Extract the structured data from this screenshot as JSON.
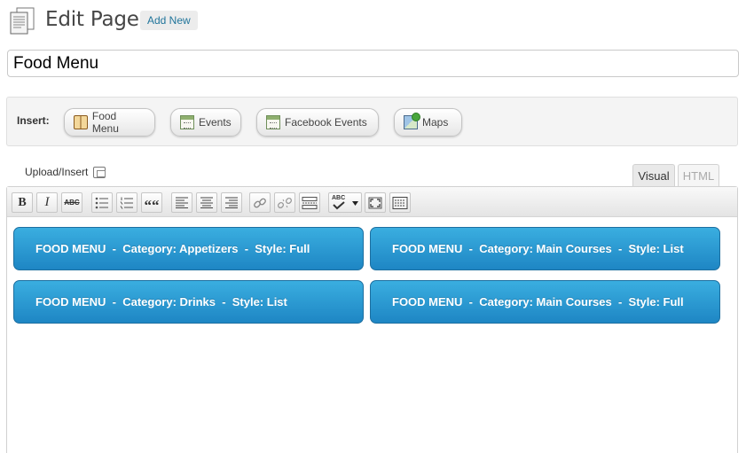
{
  "header": {
    "title": "Edit Page",
    "add_new": "Add New",
    "icon": "page-icon"
  },
  "title_field": {
    "value": "Food Menu"
  },
  "insert_bar": {
    "label": "Insert:",
    "buttons": [
      {
        "label": "Food Menu",
        "icon": "book-icon"
      },
      {
        "label": "Events",
        "icon": "calendar-icon"
      },
      {
        "label": "Facebook Events",
        "icon": "calendar-icon"
      },
      {
        "label": "Maps",
        "icon": "map-icon"
      }
    ]
  },
  "editor": {
    "upload_label": "Upload/Insert",
    "tabs": [
      "Visual",
      "HTML"
    ],
    "active_tab": "Visual",
    "toolbar": [
      "bold",
      "italic",
      "strikethrough",
      "bullet-list",
      "numbered-list",
      "blockquote",
      "align-left",
      "align-center",
      "align-right",
      "link",
      "unlink",
      "more-tag",
      "spellcheck",
      "fullscreen",
      "kitchen-sink"
    ],
    "bold_glyph": "B",
    "italic_glyph": "I",
    "strike_glyph": "ABC",
    "quote_glyph": "““",
    "spell_glyph": "ABC",
    "blocks": [
      "FOOD MENU  -  Category: Appetizers  -  Style: Full",
      "FOOD MENU  -  Category: Main Courses  -  Style: List",
      "FOOD MENU  -  Category: Drinks  -  Style: List",
      "FOOD MENU  -  Category: Main Courses  -  Style: Full"
    ]
  },
  "colors": {
    "block_top": "#3aaee0",
    "block_bottom": "#1e86c4",
    "link": "#21759b"
  }
}
